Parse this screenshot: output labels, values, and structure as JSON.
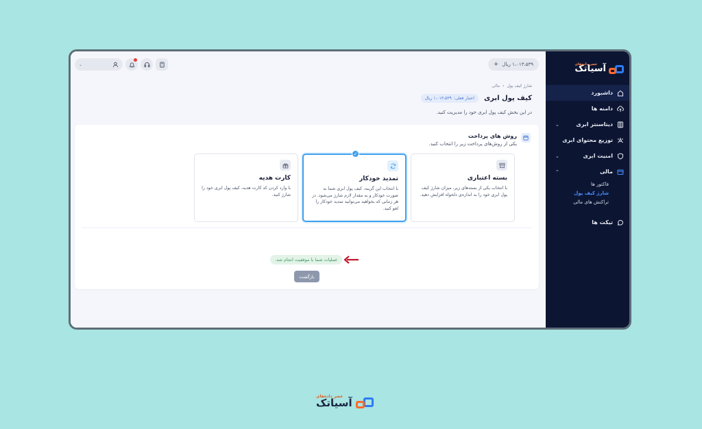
{
  "brand": {
    "name": "آسیاتک",
    "tagline": "عصر داده‌های"
  },
  "topbar": {
    "balance": "۱،۰۱۳،۵۳۹ ریال",
    "plus": "+"
  },
  "sidebar": {
    "items": [
      {
        "label": "داشبورد",
        "icon": "home-icon"
      },
      {
        "label": "دامنه ها",
        "icon": "cloud-upload-icon"
      },
      {
        "label": "دیتاسنتر ابری",
        "icon": "server-icon"
      },
      {
        "label": "توزیع محتوای ابری",
        "icon": "network-icon"
      },
      {
        "label": "امنیت ابری",
        "icon": "shield-icon"
      },
      {
        "label": "مالی",
        "icon": "wallet-icon"
      },
      {
        "label": "تیکت ها",
        "icon": "chat-icon"
      }
    ],
    "finance_sub": [
      "فاکتور ها",
      "شارژ کیف پول",
      "تراکنش های مالی"
    ]
  },
  "breadcrumb": {
    "parent": "مالی",
    "sep": "›",
    "current": "شارژ کیف پول"
  },
  "page": {
    "title": "کیف پول ابری",
    "credit_label": "اعتبار فعلی:",
    "credit_value": "۱،۰۱۳،۵۳۹ ریال",
    "description": "در این بخش کیف پول ابری خود را مدیریت کنید."
  },
  "payment": {
    "title": "روش های پرداخت",
    "subtitle": "یکی از روش‌های پرداخت زیر را انتخاب کنید.",
    "options": [
      {
        "title": "بسته اعتباری",
        "desc": "با انتخاب یکی از بسته‌های زیر، میزان شارژ کیف پول ابری خود را به اندازه‌ی دلخواه افزایش دهید."
      },
      {
        "title": "تمدید خودکار",
        "desc": "با انتخاب این گزینه، کیف پول ابری شما به صورت خودکار و به مقدار لازم شارژ می‌شود. در هر زمانی که بخواهید می‌توانید تمدید خودکار را لغو کنید."
      },
      {
        "title": "کارت هدیه",
        "desc": "با وارد کردن کد کارت هدیه، کیف پول ابری خود را شارژ کنید."
      }
    ]
  },
  "success_message": "عملیات شما با موفقیت انجام شد.",
  "back_label": "بازگشت",
  "colors": {
    "sidebar": "#0c1633",
    "accent": "#3ea0ee",
    "success_bg": "#e3f3e8",
    "arrow": "#c0182c"
  }
}
